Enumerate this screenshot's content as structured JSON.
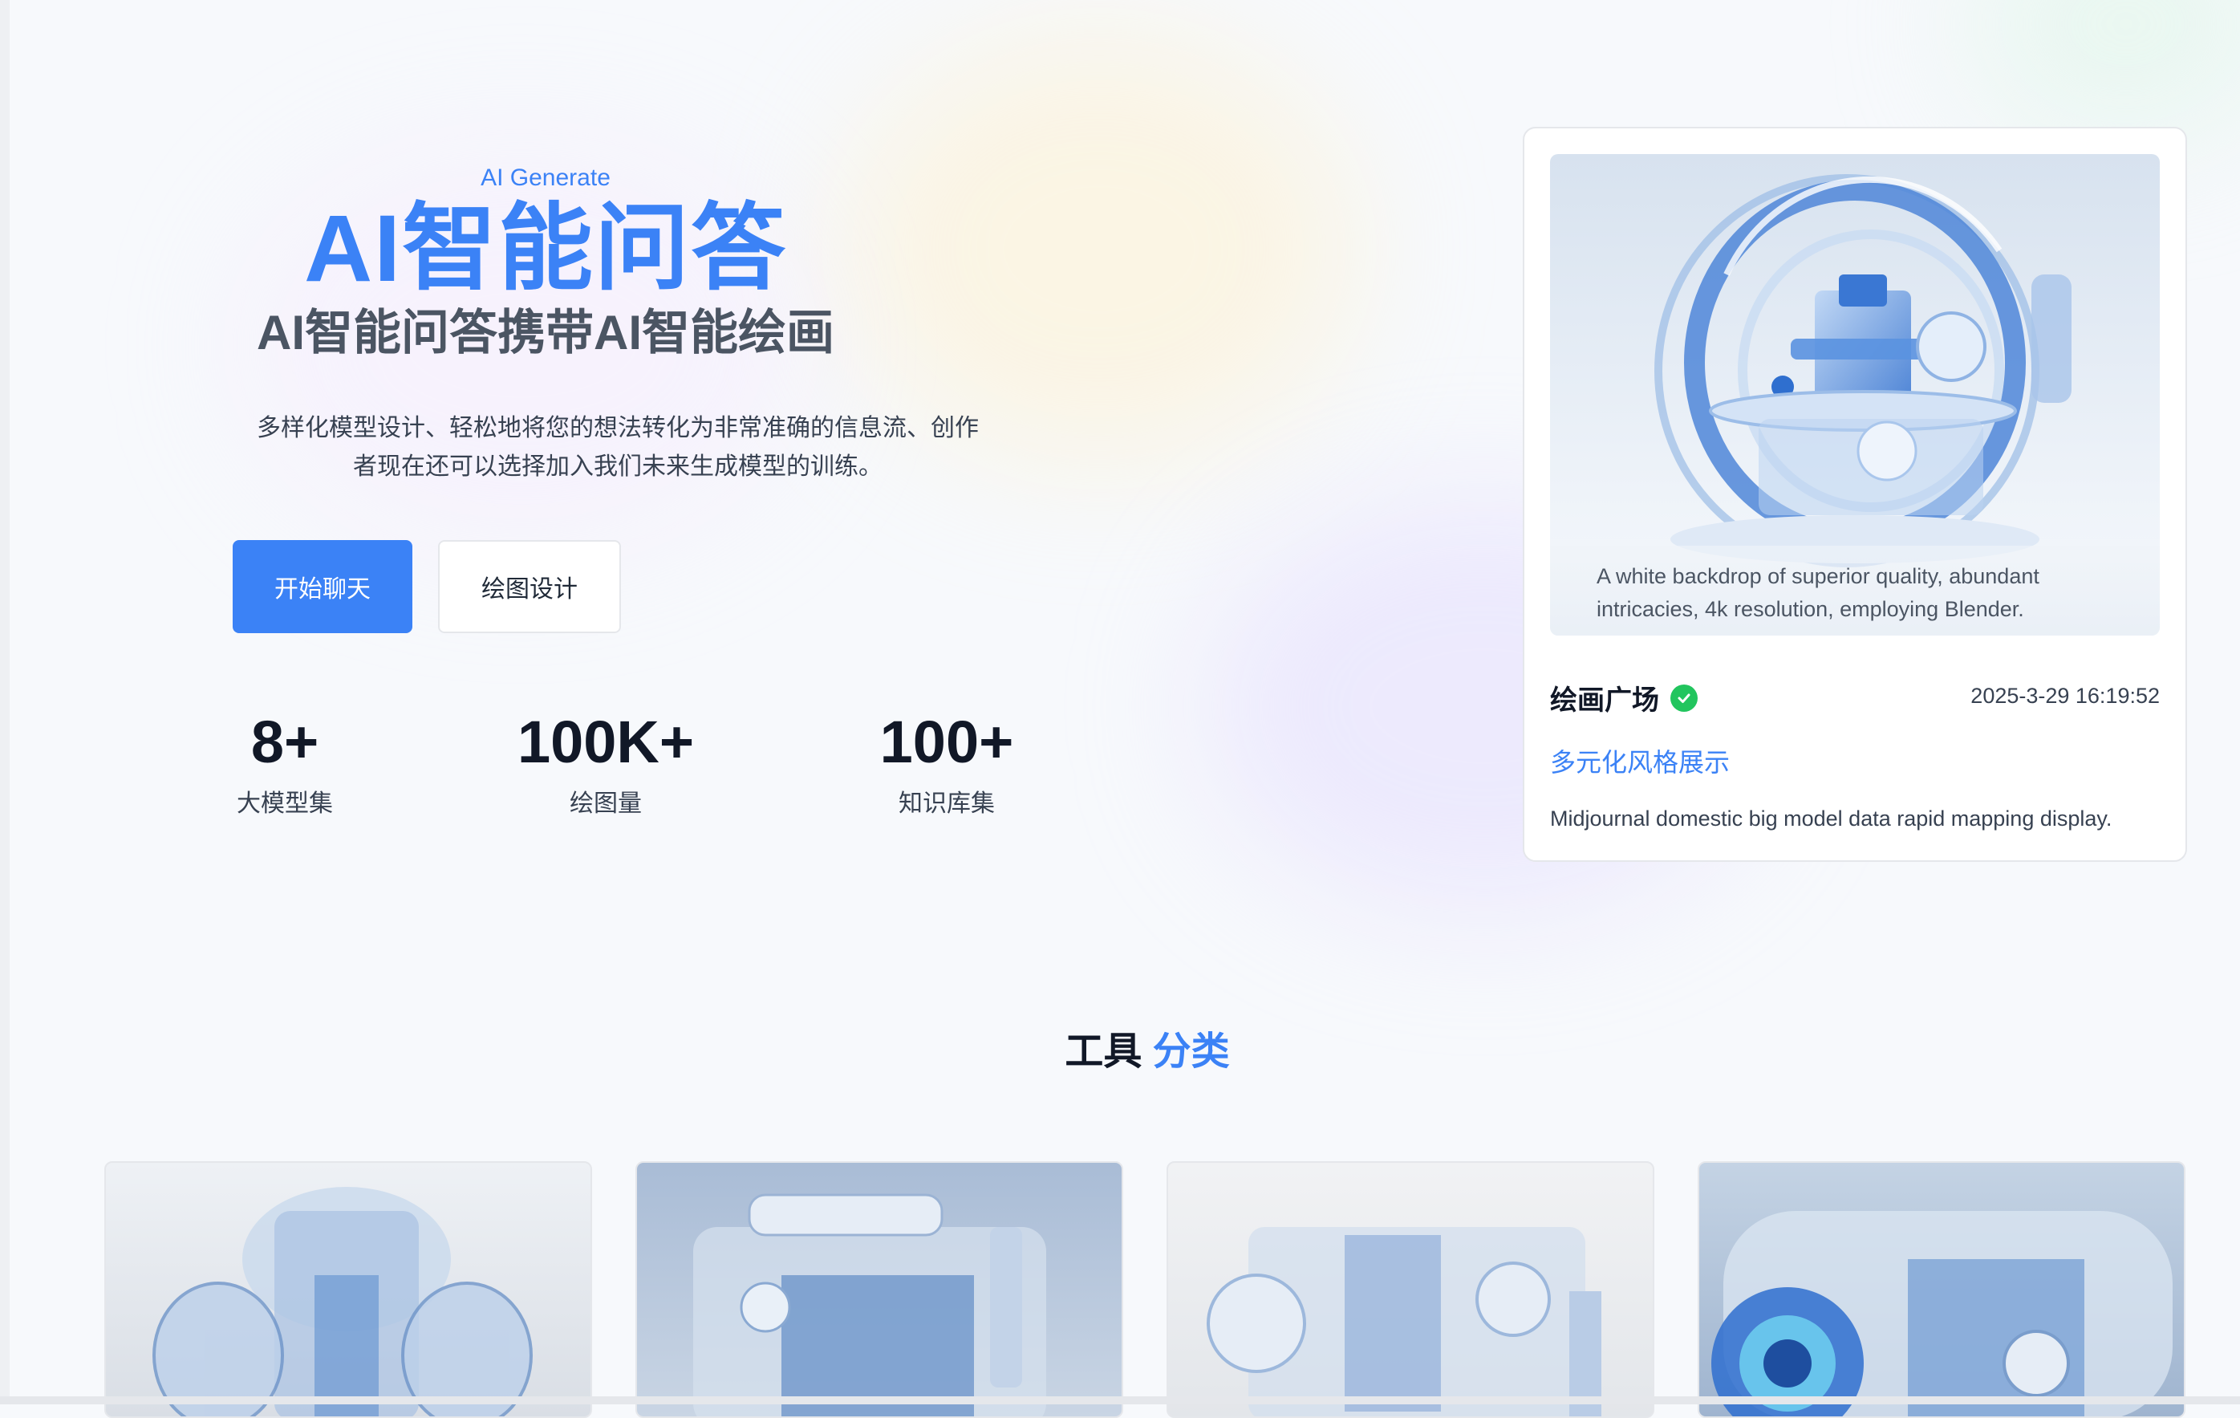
{
  "hero": {
    "eyebrow": "AI Generate",
    "title": "AI智能问答",
    "subtitle": "AI智能问答携带AI智能绘画",
    "description_line1": "多样化模型设计、轻松地将您的想法转化为非常准确的信息流、创作",
    "description_line2": "者现在还可以选择加入我们未来生成模型的训练。",
    "primary_button": "开始聊天",
    "secondary_button": "绘图设计"
  },
  "stats": [
    {
      "value": "8+",
      "label": "大模型集"
    },
    {
      "value": "100K+",
      "label": "绘图量"
    },
    {
      "value": "100+",
      "label": "知识库集"
    }
  ],
  "feature_card": {
    "caption_line1": "A white backdrop of superior quality, abundant",
    "caption_line2": "intricacies, 4k resolution, employing Blender.",
    "title": "绘画广场",
    "date": "2025-3-29 16:19:52",
    "link": "多元化风格展示",
    "description": "Midjournal domestic big model data rapid mapping display."
  },
  "tools_section": {
    "title_part1": "工具",
    "title_part2": "分类"
  },
  "colors": {
    "accent": "#3b82f6",
    "verified": "#22c55e",
    "background": "#f7f9fc"
  }
}
